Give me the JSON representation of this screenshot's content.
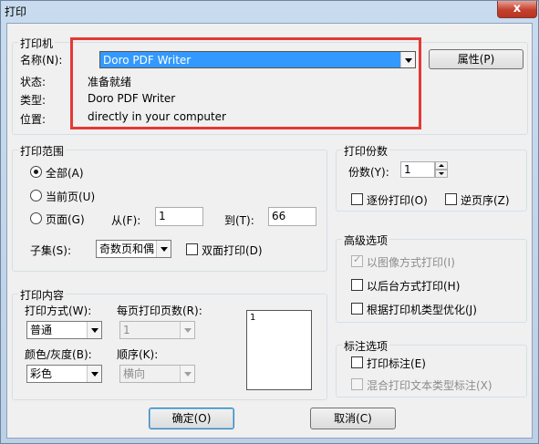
{
  "window": {
    "title": "打印",
    "close_glyph": "x"
  },
  "printer": {
    "legend": "打印机",
    "name_label": "名称(N):",
    "name_value": "Doro PDF Writer",
    "properties_label": "属性(P)",
    "status_label": "状态:",
    "status_value": "准备就绪",
    "type_label": "类型:",
    "type_value": "Doro PDF Writer",
    "location_label": "位置:",
    "location_value": "directly in your computer"
  },
  "range": {
    "legend": "打印范围",
    "all_label": "全部(A)",
    "current_label": "当前页(U)",
    "pages_label": "页面(G)",
    "from_label": "从(F):",
    "from_value": "1",
    "to_label": "到(T):",
    "to_value": "66",
    "subset_label": "子集(S):",
    "subset_value": "奇数页和偶",
    "duplex_label": "双面打印(D)"
  },
  "copies": {
    "legend": "打印份数",
    "count_label": "份数(Y):",
    "count_value": "1",
    "collate_label": "逐份打印(O)",
    "reverse_label": "逆页序(Z)"
  },
  "advanced": {
    "legend": "高级选项",
    "image_label": "以图像方式打印(I)",
    "background_label": "以后台方式打印(H)",
    "optimize_label": "根据打印机类型优化(J)"
  },
  "content": {
    "legend": "打印内容",
    "mode_label": "打印方式(W):",
    "mode_value": "普通",
    "pages_per_sheet_label": "每页打印页数(R):",
    "pages_per_sheet_value": "1",
    "color_label": "颜色/灰度(B):",
    "color_value": "彩色",
    "order_label": "顺序(K):",
    "order_value": "横向",
    "preview_text": "1"
  },
  "annotation": {
    "legend": "标注选项",
    "print_label": "打印标注(E)",
    "mixed_label": "混合打印文本类型标注(X)"
  },
  "buttons": {
    "ok_label": "确定(O)",
    "cancel_label": "取消(C)"
  },
  "colors": {
    "highlight": "#e53935",
    "selection": "#3399ff"
  }
}
